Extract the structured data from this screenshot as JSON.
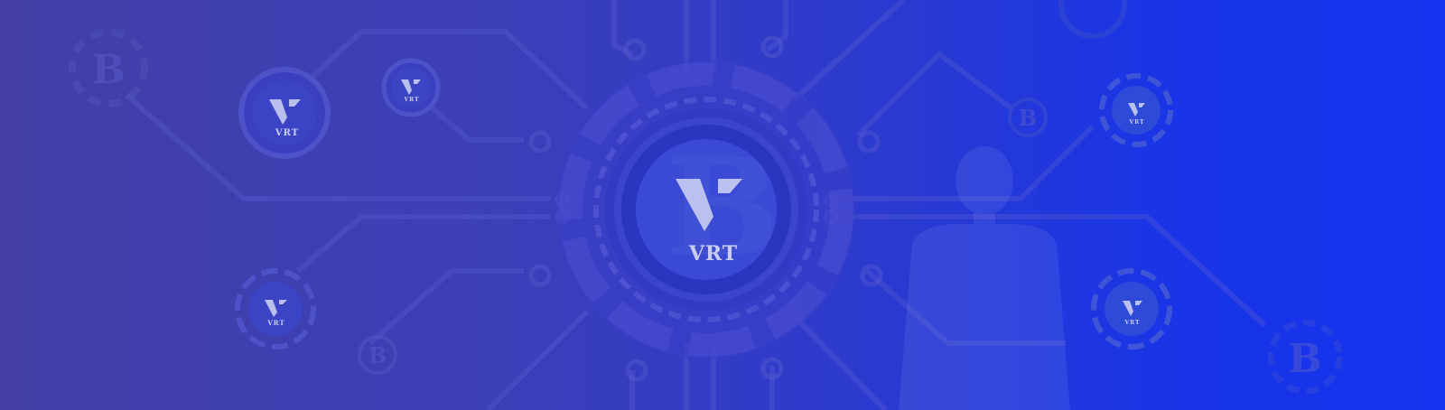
{
  "banner": {
    "brand": {
      "main_logo_text": "VRT",
      "small_coin_text": "VRT"
    },
    "colors": {
      "gradient_start": "#433fa6",
      "gradient_end": "#1433ee",
      "accent": "#c9cdf2"
    },
    "icons": [
      "vrt-logo-icon",
      "bitcoin-icon",
      "circuit-lines-decoration",
      "person-silhouette"
    ]
  }
}
